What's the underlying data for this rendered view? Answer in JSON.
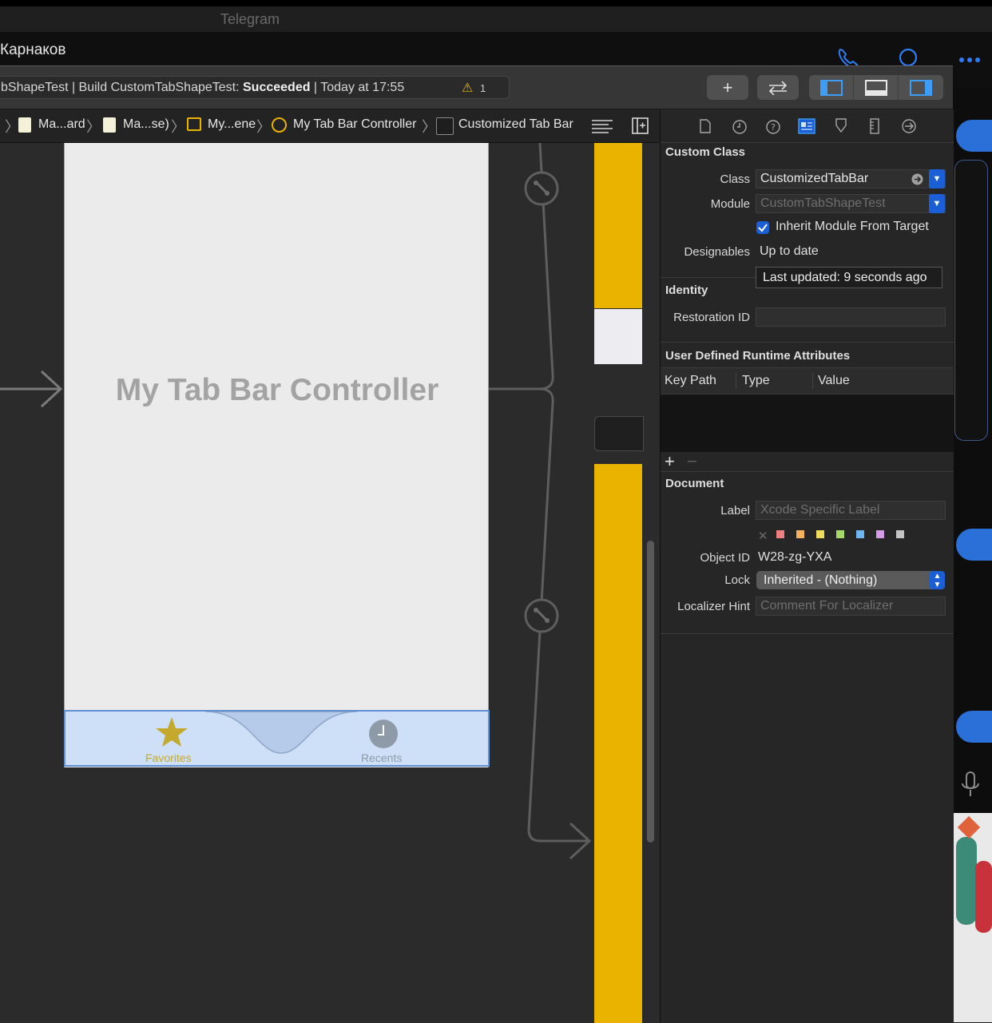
{
  "telegram": {
    "title": "Telegram",
    "contact_name": "Карнаков"
  },
  "status": {
    "prefix": "bShapeTest | Build CustomTabShapeTest: ",
    "result": "Succeeded",
    "suffix": " | Today at 17:55",
    "warning_count": "1"
  },
  "jumpbar": {
    "items": [
      "Ma...ard",
      "Ma...se)",
      "My...ene",
      "My Tab Bar Controller",
      "Customized Tab Bar"
    ]
  },
  "canvas": {
    "screen_title": "My Tab Bar Controller",
    "tabs": [
      {
        "label": "Favorites"
      },
      {
        "label": "Recents"
      }
    ]
  },
  "inspector": {
    "custom_class": {
      "title": "Custom Class",
      "class_label": "Class",
      "class_value": "CustomizedTabBar",
      "module_label": "Module",
      "module_placeholder": "CustomTabShapeTest",
      "inherit_label": "Inherit Module From Target",
      "designables_label": "Designables",
      "designables_value": "Up to date",
      "tooltip": "Last updated: 9 seconds ago"
    },
    "identity": {
      "title": "Identity",
      "restoration_label": "Restoration ID",
      "restoration_value": ""
    },
    "runtime_attrs": {
      "title": "User Defined Runtime Attributes",
      "columns": [
        "Key Path",
        "Type",
        "Value"
      ],
      "add": "+",
      "remove": "−"
    },
    "document": {
      "title": "Document",
      "label_label": "Label",
      "label_placeholder": "Xcode Specific Label",
      "object_id_label": "Object ID",
      "object_id_value": "W28-zg-YXA",
      "lock_label": "Lock",
      "lock_value": "Inherited - (Nothing)",
      "localizer_label": "Localizer Hint",
      "localizer_placeholder": "Comment For Localizer",
      "swatches": [
        "#f07f7f",
        "#f4b25e",
        "#efdc5c",
        "#a6d96a",
        "#6fb5f2",
        "#d49be8",
        "#c4c4c4"
      ]
    }
  },
  "colors": {
    "accent": "#1a5fd6",
    "tab_selected": "#c4a92d",
    "yellow_view": "#e9b300"
  }
}
